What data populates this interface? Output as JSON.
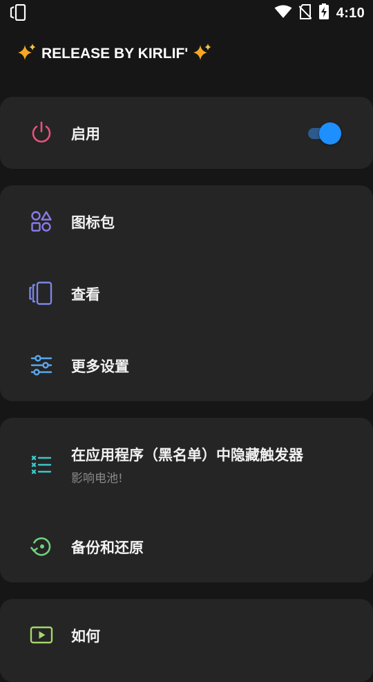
{
  "status_bar": {
    "time": "4:10",
    "icons": [
      "phone-rotate-icon",
      "wifi-icon",
      "no-sim-icon",
      "battery-charging-icon"
    ]
  },
  "header": {
    "title": "RELEASE BY KIRLIF'",
    "left_icon": "sparkles-icon",
    "right_icon": "sparkles-icon"
  },
  "cards": [
    {
      "items": [
        {
          "label": "启用",
          "icon": "power-icon",
          "icon_color": "#e9527f",
          "toggle_on": true
        }
      ]
    },
    {
      "items": [
        {
          "label": "图标包",
          "icon": "shapes-icon",
          "icon_color": "#8a7be8"
        },
        {
          "label": "查看",
          "icon": "cards-view-icon",
          "icon_color": "#7b86e6"
        },
        {
          "label": "更多设置",
          "icon": "sliders-icon",
          "icon_color": "#5aa9f0"
        }
      ]
    },
    {
      "items": [
        {
          "label": "在应用程序（黑名单）中隐藏触发器",
          "sublabel": "影响电池!",
          "icon": "checklist-icon",
          "icon_color": "#3cc6c9"
        },
        {
          "label": "备份和还原",
          "icon": "restore-icon",
          "icon_color": "#6fd17d"
        }
      ]
    },
    {
      "items": [
        {
          "label": "如何",
          "icon": "play-video-icon",
          "icon_color": "#a6d66a"
        }
      ]
    }
  ],
  "colors": {
    "background": "#161616",
    "card": "#252525",
    "accent": "#1e8fff"
  }
}
